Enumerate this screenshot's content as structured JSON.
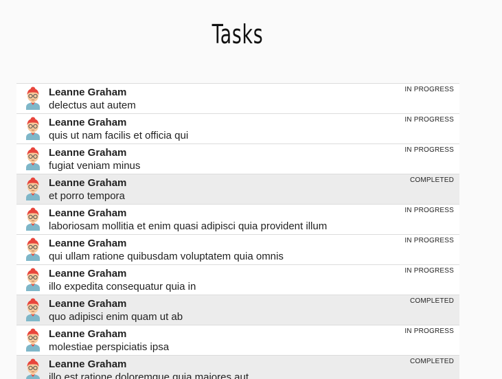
{
  "title": "Tasks",
  "tasks": [
    {
      "user": "Leanne Graham",
      "title": "delectus aut autem",
      "status": "IN PROGRESS",
      "completed": false
    },
    {
      "user": "Leanne Graham",
      "title": "quis ut nam facilis et officia qui",
      "status": "IN PROGRESS",
      "completed": false
    },
    {
      "user": "Leanne Graham",
      "title": "fugiat veniam minus",
      "status": "IN PROGRESS",
      "completed": false
    },
    {
      "user": "Leanne Graham",
      "title": "et porro tempora",
      "status": "COMPLETED",
      "completed": true
    },
    {
      "user": "Leanne Graham",
      "title": "laboriosam mollitia et enim quasi adipisci quia provident illum",
      "status": "IN PROGRESS",
      "completed": false
    },
    {
      "user": "Leanne Graham",
      "title": "qui ullam ratione quibusdam voluptatem quia omnis",
      "status": "IN PROGRESS",
      "completed": false
    },
    {
      "user": "Leanne Graham",
      "title": "illo expedita consequatur quia in",
      "status": "IN PROGRESS",
      "completed": false
    },
    {
      "user": "Leanne Graham",
      "title": "quo adipisci enim quam ut ab",
      "status": "COMPLETED",
      "completed": true
    },
    {
      "user": "Leanne Graham",
      "title": "molestiae perspiciatis ipsa",
      "status": "IN PROGRESS",
      "completed": false
    },
    {
      "user": "Leanne Graham",
      "title": "illo est ratione doloremque quia maiores aut",
      "status": "COMPLETED",
      "completed": true
    }
  ],
  "colors": {
    "completed_row_bg": "#ececec",
    "row_bg": "#ffffff",
    "divider": "#dcdcdc",
    "avatar_hair": "#e8453c",
    "avatar_skin": "#f7c99b",
    "avatar_shirt": "#7fb7c9"
  },
  "icons": {
    "avatar": "user-avatar-icon"
  }
}
